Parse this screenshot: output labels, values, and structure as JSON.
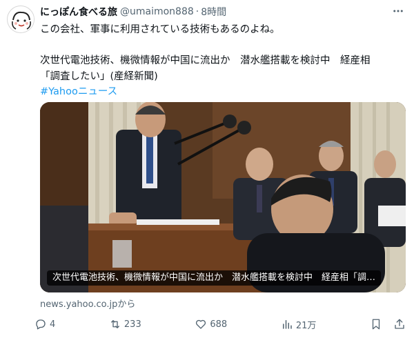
{
  "author": {
    "display_name": "にっぽん食べる旅",
    "handle": "@umaimon888",
    "separator": "·",
    "time": "8時間"
  },
  "body": {
    "line1": "この会社、軍事に利用されている技術もあるのよね。",
    "line2": "次世代電池技術、機微情報が中国に流出か　潜水艦搭載を検討中　経産相",
    "line3": "「調査したい」(産経新聞)",
    "hashtag": "#Yahooニュース"
  },
  "card": {
    "caption": "次世代電池技術、機微情報が中国に流出か　潜水艦搭載を検討中　経産相「調…",
    "source": "news.yahoo.co.jpから"
  },
  "actions": {
    "replies": "4",
    "reposts": "233",
    "likes": "688",
    "views": "21万"
  },
  "icons": {
    "more": "more-icon",
    "reply": "reply-icon",
    "repost": "repost-icon",
    "like": "heart-icon",
    "views": "analytics-icon",
    "bookmark": "bookmark-icon",
    "share": "share-icon"
  },
  "colors": {
    "text": "#0f1419",
    "muted": "#536471",
    "link": "#1d9bf0"
  }
}
